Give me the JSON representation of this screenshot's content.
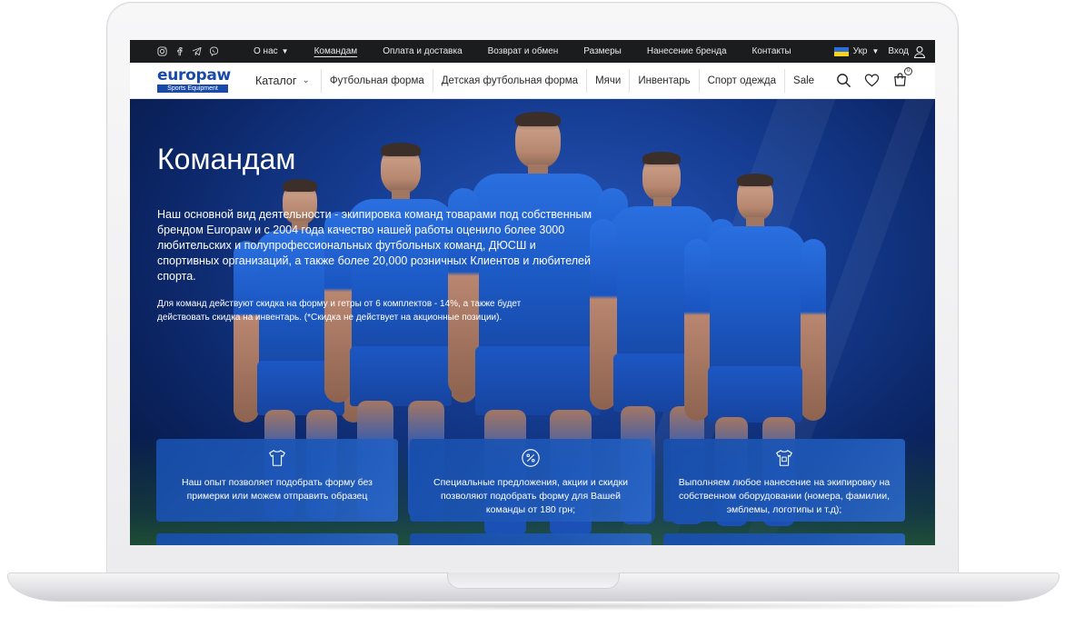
{
  "topbar": {
    "social": [
      "instagram-icon",
      "facebook-icon",
      "telegram-icon",
      "viber-icon"
    ],
    "nav": [
      {
        "label": "О нас",
        "dropdown": true,
        "active": false
      },
      {
        "label": "Командам",
        "dropdown": false,
        "active": true
      },
      {
        "label": "Оплата и доставка",
        "dropdown": false,
        "active": false
      },
      {
        "label": "Возврат и обмен",
        "dropdown": false,
        "active": false
      },
      {
        "label": "Размеры",
        "dropdown": false,
        "active": false
      },
      {
        "label": "Нанесение бренда",
        "dropdown": false,
        "active": false
      },
      {
        "label": "Контакты",
        "dropdown": false,
        "active": false
      }
    ],
    "language": "Укр",
    "login": "Вход"
  },
  "header": {
    "logo_text": "europaw",
    "logo_tagline": "Sports Equipment",
    "catalog_label": "Каталог",
    "categories": [
      "Футбольная форма",
      "Детская футбольная форма",
      "Мячи",
      "Инвентарь",
      "Спорт одежда",
      "Sale"
    ],
    "cart_count": "0"
  },
  "hero": {
    "title": "Командам",
    "paragraph1": "Наш основной вид деятельности - экипировка команд товарами под собственным брендом Europaw и с 2004 года качество нашей работы оценило более 3000 любительских и полупрофессиональных футбольных команд, ДЮСШ и спортивных организаций, а также более 20,000 розничных Клиентов и любителей спорта.",
    "paragraph2": "Для команд действуют скидка на форму и гетры от 6 комплектов - 14%, а также будет действовать скидка на инвентарь. (*Скидка не действует на акционные позиции)."
  },
  "cards": [
    {
      "icon": "tshirt-icon",
      "text": "Наш опыт позволяет подобрать форму без примерки или можем отправить образец"
    },
    {
      "icon": "percent-icon",
      "text": "Специальные предложения, акции и скидки позволяют подобрать форму для Вашей команды от 180 грн;"
    },
    {
      "icon": "printed-tshirt-icon",
      "text": "Выполняем любое нанесение на экипировку на собственном оборудовании (номера, фамилии, эмблемы, логотипы и т.д);"
    }
  ],
  "colors": {
    "brand": "#1a4aa8",
    "topbar_bg": "#1b1c1e",
    "card_bg": "#1e58b8"
  }
}
